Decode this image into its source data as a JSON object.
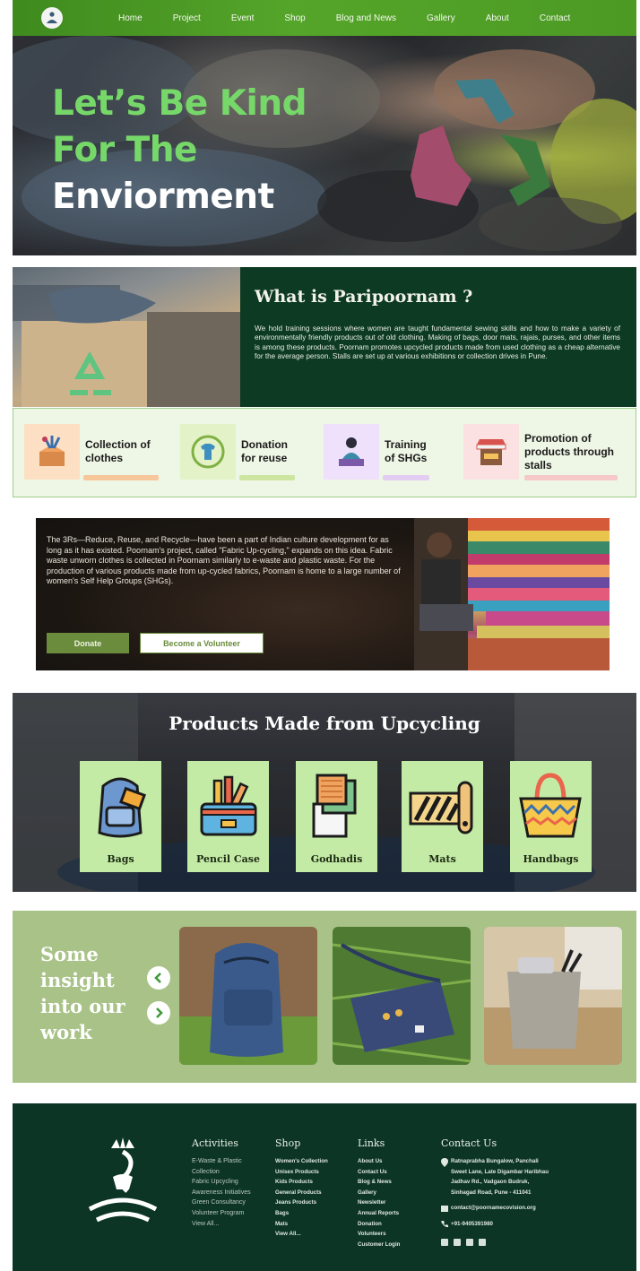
{
  "nav": {
    "logo_icon": "meditating-figure-logo-icon",
    "links": [
      "Home",
      "Project",
      "Event",
      "Shop",
      "Blog and News",
      "Gallery",
      "About",
      "Contact"
    ]
  },
  "hero": {
    "line1": "Let’s Be Kind",
    "line2": "For The",
    "line3": "Enviorment",
    "recycle_icon": "recycle-clothes-icon"
  },
  "about": {
    "title": "What is Paripoornam ?",
    "text": "We hold training sessions where women are taught fundamental sewing skills and how to make a variety of environmentally friendly products out of old clothing. Making of bags, door mats, rajais, purses, and other items is among these products. Poornam promotes upcycled products made from used clothing as a cheap alternative for the average person. Stalls are set up at various exhibitions or collection drives in Pune.",
    "image_icon": "recycle-box-icon"
  },
  "features": [
    {
      "label": "Collection of clothes",
      "icon": "clothes-box-icon",
      "color": "#f7c79c"
    },
    {
      "label": "Donation for reuse",
      "icon": "shirt-cycle-icon",
      "color": "#cce6a2"
    },
    {
      "label": "Training of SHGs",
      "icon": "sewing-woman-icon",
      "color": "#e3cdf3"
    },
    {
      "label": "Promotion of products through stalls",
      "icon": "market-stall-icon",
      "color": "#f6c9c9"
    }
  ],
  "threer": {
    "text": "The 3Rs—Reduce, Reuse, and Recycle—have been a part of Indian culture development for as long as it has existed. Poornam's project, called \"Fabric Up-cycling,\" expands on this idea. Fabric waste unworn clothes is collected in Poornam similarly to e-waste and plastic waste. For the production of various products made from up-cycled fabrics, Poornam is home to a large number of women's Self Help Groups (SHGs).",
    "donate_label": "Donate",
    "volunteer_label": "Become a Volunteer",
    "accent": "#6a8c3c"
  },
  "products": {
    "title": "Products Made from Upcycling",
    "items": [
      {
        "label": "Bags",
        "icon": "backpack-icon"
      },
      {
        "label": "Pencil Case",
        "icon": "pencil-case-icon"
      },
      {
        "label": "Godhadis",
        "icon": "quilt-icon"
      },
      {
        "label": "Mats",
        "icon": "rolled-mat-icon"
      },
      {
        "label": "Handbags",
        "icon": "handbag-icon"
      }
    ]
  },
  "insight": {
    "title_lines": [
      "Some",
      "insight",
      "into our",
      "work"
    ],
    "prev_icon": "chevron-left-icon",
    "next_icon": "chevron-right-icon"
  },
  "footer": {
    "logo_icon": "lotus-figure-logo-icon",
    "activities": {
      "heading": "Activities",
      "items": [
        "E-Waste & Plastic",
        "Collection",
        "Fabric Upcycling",
        "Awareness Initiatives",
        "Green Consultancy",
        "Volunteer Program",
        "View All..."
      ]
    },
    "shop": {
      "heading": "Shop",
      "items": [
        "Women's Collection",
        "Unisex Products",
        "Kids Products",
        "General Products",
        "Jeans Products",
        "Bags",
        "Mats",
        "View All..."
      ]
    },
    "links": {
      "heading": "Links",
      "items": [
        "About Us",
        "Contact Us",
        "Blog & News",
        "Gallery",
        "Newsletter",
        "Annual Reports",
        "Donation",
        "Volunteers",
        "Customer Login"
      ]
    },
    "contact": {
      "heading": "Contact Us",
      "address_lines": [
        "Ratnaprabha Bungalow, Panchali",
        "Sweet Lane, Late Digambar Haribhau",
        "Jadhav Rd., Vadgaon Budruk,",
        "Sinhagad Road, Pune - 411041"
      ],
      "email": "contact@poornamecovision.org",
      "phone": "+91-9405391980",
      "social_icons": [
        "facebook-icon",
        "instagram-icon",
        "linkedin-icon",
        "youtube-icon"
      ]
    }
  }
}
